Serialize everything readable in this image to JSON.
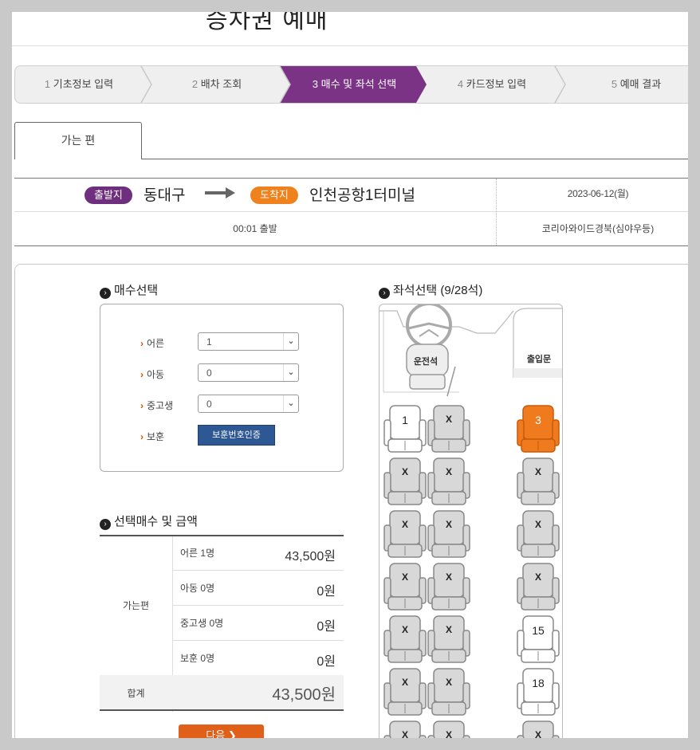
{
  "page": {
    "title": "승차권 예매"
  },
  "steps": [
    {
      "num": "1",
      "label": "기초정보 입력",
      "active": false
    },
    {
      "num": "2",
      "label": "배차 조회",
      "active": false
    },
    {
      "num": "3",
      "label": "매수 및 좌석 선택",
      "active": true
    },
    {
      "num": "4",
      "label": "카드정보 입력",
      "active": false
    },
    {
      "num": "5",
      "label": "예매 결과",
      "active": false
    }
  ],
  "tab": {
    "label": "가는 편"
  },
  "route": {
    "departure_badge": "출발지",
    "departure": "동대구",
    "arrival_badge": "도착지",
    "arrival": "인천공항1터미널",
    "date": "2023-06-12(월)",
    "departure_time": "00:01 출발",
    "bus_company": "코리아와이드경북(심야우등)"
  },
  "count_section": {
    "title": "매수선택",
    "rows": [
      {
        "label": "어른",
        "value": "1"
      },
      {
        "label": "아동",
        "value": "0"
      },
      {
        "label": "중고생",
        "value": "0"
      }
    ],
    "veteran_label": "보훈",
    "veteran_button": "보훈번호인증"
  },
  "price_section": {
    "title": "선택매수 및 금액",
    "group_label": "가는편",
    "items": [
      {
        "label": "어른 1명",
        "price": "43,500원"
      },
      {
        "label": "아동 0명",
        "price": "0원"
      },
      {
        "label": "중고생 0명",
        "price": "0원"
      },
      {
        "label": "보훈 0명",
        "price": "0원"
      }
    ],
    "total_label": "합계",
    "total_price": "43,500원"
  },
  "next_button": "다음",
  "seat_section": {
    "title": "좌석선택 (9/28석)",
    "driver_label": "운전석",
    "door_label": "출입문",
    "seats": [
      {
        "label": "1",
        "state": "available"
      },
      {
        "label": "X",
        "state": "taken"
      },
      {
        "label": "3",
        "state": "selected"
      },
      {
        "label": "X",
        "state": "taken"
      },
      {
        "label": "X",
        "state": "taken"
      },
      {
        "label": "X",
        "state": "taken"
      },
      {
        "label": "X",
        "state": "taken"
      },
      {
        "label": "X",
        "state": "taken"
      },
      {
        "label": "X",
        "state": "taken"
      },
      {
        "label": "X",
        "state": "taken"
      },
      {
        "label": "X",
        "state": "taken"
      },
      {
        "label": "X",
        "state": "taken"
      },
      {
        "label": "X",
        "state": "taken"
      },
      {
        "label": "X",
        "state": "taken"
      },
      {
        "label": "15",
        "state": "available"
      },
      {
        "label": "X",
        "state": "taken"
      },
      {
        "label": "X",
        "state": "taken"
      },
      {
        "label": "18",
        "state": "available"
      },
      {
        "label": "X",
        "state": "taken"
      },
      {
        "label": "X",
        "state": "taken"
      },
      {
        "label": "X",
        "state": "taken"
      }
    ]
  },
  "colors": {
    "brand_purple": "#6d2f7e",
    "accent_orange": "#f0821e",
    "button_orange": "#e0601a",
    "button_blue": "#2e5894"
  }
}
